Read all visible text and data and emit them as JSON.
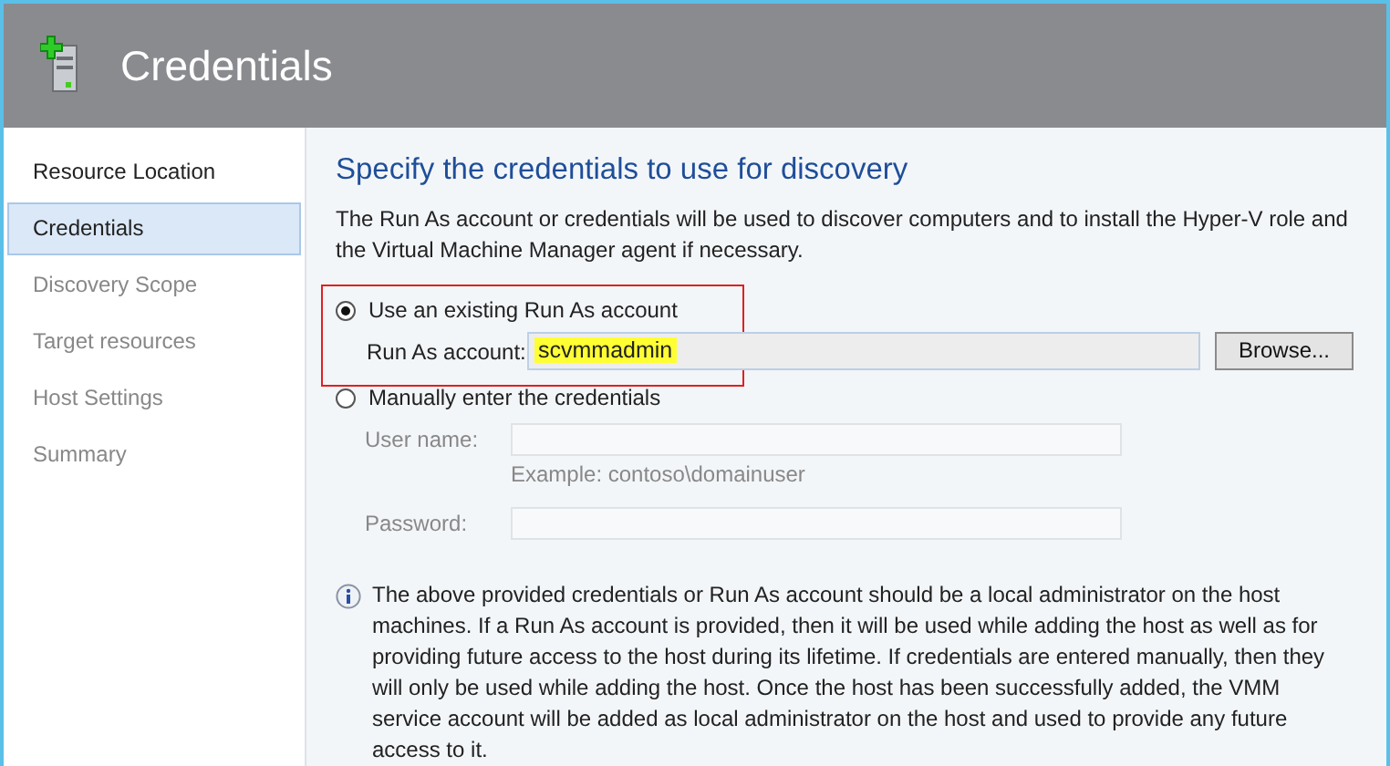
{
  "window": {
    "title": "Credentials"
  },
  "sidebar": {
    "items": [
      {
        "label": "Resource Location",
        "selected": false,
        "disabled": false
      },
      {
        "label": "Credentials",
        "selected": true,
        "disabled": false
      },
      {
        "label": "Discovery Scope",
        "selected": false,
        "disabled": true
      },
      {
        "label": "Target resources",
        "selected": false,
        "disabled": true
      },
      {
        "label": "Host Settings",
        "selected": false,
        "disabled": true
      },
      {
        "label": "Summary",
        "selected": false,
        "disabled": true
      }
    ]
  },
  "heading": "Specify the credentials to use for discovery",
  "description": "The Run As account or credentials will be used to discover computers and to install the Hyper-V role and the Virtual Machine Manager agent if necessary.",
  "existing_option": {
    "label": "Use an existing Run As account",
    "selected": true,
    "outlined": true,
    "field_label": "Run As account:",
    "value": "scvmmadmin",
    "highlighted": true,
    "button": "Browse..."
  },
  "manual_option": {
    "label": "Manually enter the credentials",
    "selected": false,
    "user_label": "User name:",
    "example": "Example: contoso\\domainuser",
    "password_label": "Password:"
  },
  "note": "The above provided credentials or Run As account should be a local administrator on the host machines. If a Run As account is provided, then it will be used while adding the host as well as for providing future access to the host during its lifetime. If credentials are entered manually, then they will only be used while adding the host. Once the host has been successfully added, the VMM service account will be added as local administrator on the host and used to provide any future access to it."
}
